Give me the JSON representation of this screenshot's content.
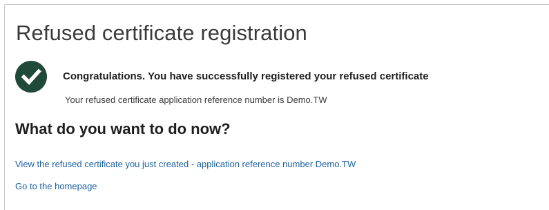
{
  "page": {
    "title": "Refused certificate registration"
  },
  "confirmation": {
    "icon": "checkmark-circle-icon",
    "icon_color": "#1f4a3a",
    "heading": "Congratulations. You have successfully registered your refused certificate",
    "reference_line": "Your refused certificate application reference number is Demo.TW"
  },
  "next_steps": {
    "heading": "What do you want to do now?",
    "links": [
      {
        "label": "View the refused certificate you just created - application reference number Demo.TW"
      },
      {
        "label": "Go to the homepage"
      }
    ],
    "link_color": "#1a5fa8"
  }
}
